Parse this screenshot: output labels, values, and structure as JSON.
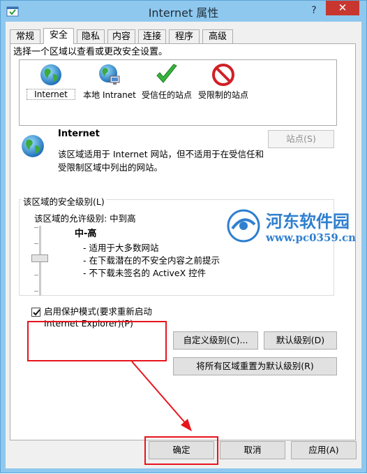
{
  "window": {
    "title": "Internet 属性",
    "help_label": "?",
    "close_label": "✕"
  },
  "tabs": [
    "常规",
    "安全",
    "隐私",
    "内容",
    "连接",
    "程序",
    "高级"
  ],
  "active_tab": "安全",
  "security": {
    "instruction": "选择一个区域以查看或更改安全设置。",
    "zones": [
      {
        "label": "Internet",
        "icon": "globe-icon"
      },
      {
        "label": "本地 Intranet",
        "icon": "intranet-globe-icon"
      },
      {
        "label": "受信任的站点",
        "icon": "green-check-icon"
      },
      {
        "label": "受限制的站点",
        "icon": "red-prohibited-icon"
      }
    ],
    "selected_zone": {
      "name": "Internet",
      "description": "该区域适用于 Internet 网站，但不适用于在受信任和受限制区域中列出的网站。"
    },
    "sites_button": "站点(S)",
    "level_group_title": "该区域的安全级别(L)",
    "allowed_levels": "该区域的允许级别: 中到高",
    "level_name": "中-高",
    "level_bullets": [
      "- 适用于大多数网站",
      "- 在下载潜在的不安全内容之前提示",
      "- 不下载未签名的 ActiveX 控件"
    ],
    "protected_mode_label": "启用保护模式(要求重新启动 Internet Explorer)(P)",
    "protected_mode_checked": true,
    "custom_level_button": "自定义级别(C)...",
    "default_level_button": "默认级别(D)",
    "reset_all_button": "将所有区域重置为默认级别(R)"
  },
  "footer": {
    "ok": "确定",
    "cancel": "取消",
    "apply": "应用(A)"
  },
  "watermark": {
    "text": "河东软件园",
    "url": "www.pc0359.cn"
  },
  "colors": {
    "highlight": "#e8141b",
    "titlebar": "#8fc8ee",
    "close": "#c7372f"
  }
}
